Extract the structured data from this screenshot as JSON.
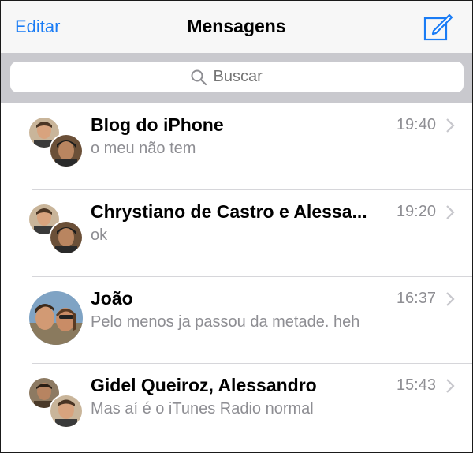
{
  "navbar": {
    "edit_label": "Editar",
    "title": "Mensagens",
    "compose_icon": "compose-icon",
    "accent_color": "#1a7cf5"
  },
  "search": {
    "placeholder": "Buscar",
    "icon": "search-icon"
  },
  "conversations": [
    {
      "name": "Blog do iPhone",
      "time": "19:40",
      "preview": "o meu não tem",
      "avatar": "group"
    },
    {
      "name": "Chrystiano de Castro e Alessa...",
      "time": "19:20",
      "preview": "ok",
      "avatar": "group"
    },
    {
      "name": "João",
      "time": "16:37",
      "preview": "Pelo menos ja passou da metade. heh",
      "avatar": "single"
    },
    {
      "name": "Gidel Queiroz, Alessandro",
      "time": "15:43",
      "preview": "Mas aí é o iTunes Radio normal",
      "avatar": "group"
    }
  ]
}
